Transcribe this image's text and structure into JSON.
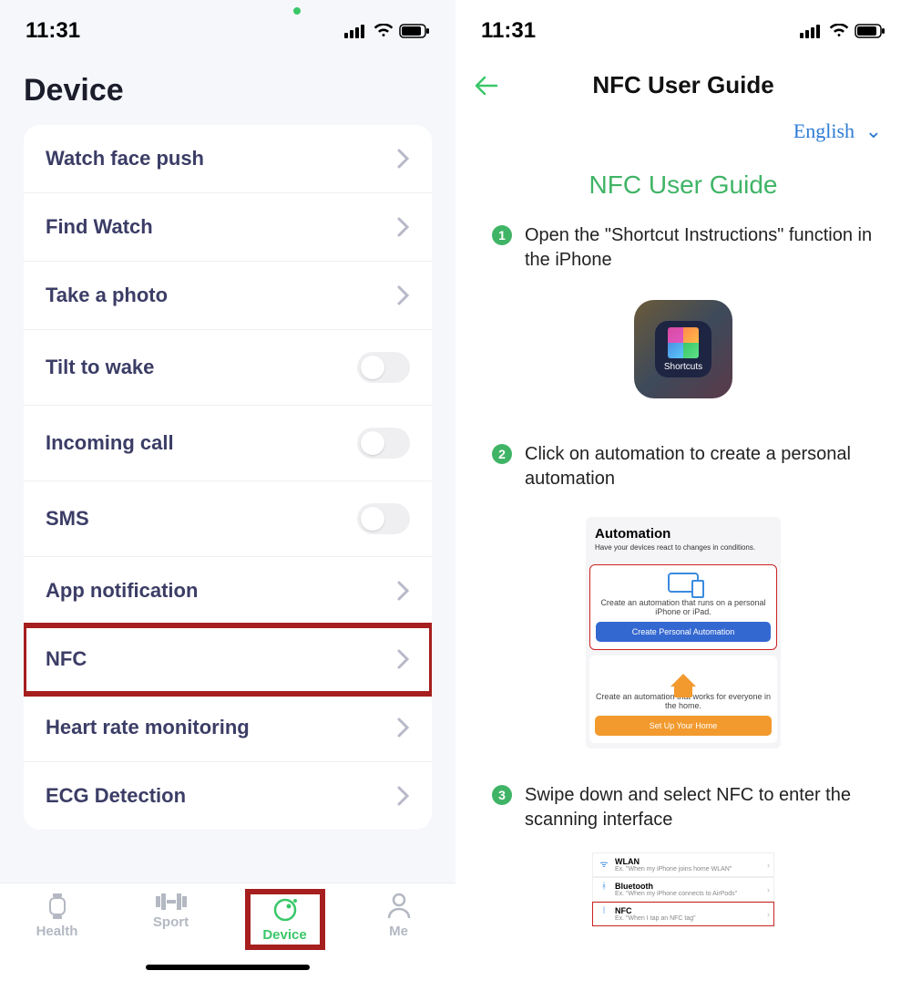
{
  "status": {
    "time": "11:31"
  },
  "left": {
    "title": "Device",
    "rows": [
      {
        "id": "watch-face-push",
        "label": "Watch face push",
        "type": "nav"
      },
      {
        "id": "find-watch",
        "label": "Find Watch",
        "type": "nav"
      },
      {
        "id": "take-a-photo",
        "label": "Take a photo",
        "type": "nav"
      },
      {
        "id": "tilt-to-wake",
        "label": "Tilt to wake",
        "type": "toggle",
        "on": false
      },
      {
        "id": "incoming-call",
        "label": "Incoming call",
        "type": "toggle",
        "on": false
      },
      {
        "id": "sms",
        "label": "SMS",
        "type": "toggle",
        "on": false
      },
      {
        "id": "app-notification",
        "label": "App notification",
        "type": "nav"
      },
      {
        "id": "nfc",
        "label": "NFC",
        "type": "nav",
        "highlighted": true
      },
      {
        "id": "heart-rate-monitoring",
        "label": "Heart rate monitoring",
        "type": "nav"
      },
      {
        "id": "ecg-detection",
        "label": "ECG Detection",
        "type": "nav"
      }
    ],
    "tabs": [
      {
        "id": "health",
        "label": "Health"
      },
      {
        "id": "sport",
        "label": "Sport"
      },
      {
        "id": "device",
        "label": "Device",
        "active": true,
        "highlighted": true
      },
      {
        "id": "me",
        "label": "Me"
      }
    ]
  },
  "right": {
    "nav_title": "NFC User Guide",
    "language": "English",
    "heading": "NFC User Guide",
    "steps": {
      "s1": "Open the \"Shortcut Instructions\" function in the iPhone",
      "s2": "Click on automation to create a personal automation",
      "s3": "Swipe down and select NFC to enter the scanning interface"
    },
    "shortcuts_label": "Shortcuts",
    "automation": {
      "title": "Automation",
      "subtitle": "Have your devices react to changes in conditions.",
      "personal_caption": "Create an automation that runs on a personal iPhone or iPad.",
      "personal_button": "Create Personal Automation",
      "home_caption": "Create an automation that works for everyone in the home.",
      "home_button": "Set Up Your Home"
    },
    "triggers": {
      "wlan": {
        "title": "WLAN",
        "sub": "Ex. \"When my iPhone joins home WLAN\""
      },
      "bluetooth": {
        "title": "Bluetooth",
        "sub": "Ex. \"When my iPhone connects to AirPods\""
      },
      "nfc": {
        "title": "NFC",
        "sub": "Ex. \"When I tap an NFC tag\""
      }
    }
  }
}
